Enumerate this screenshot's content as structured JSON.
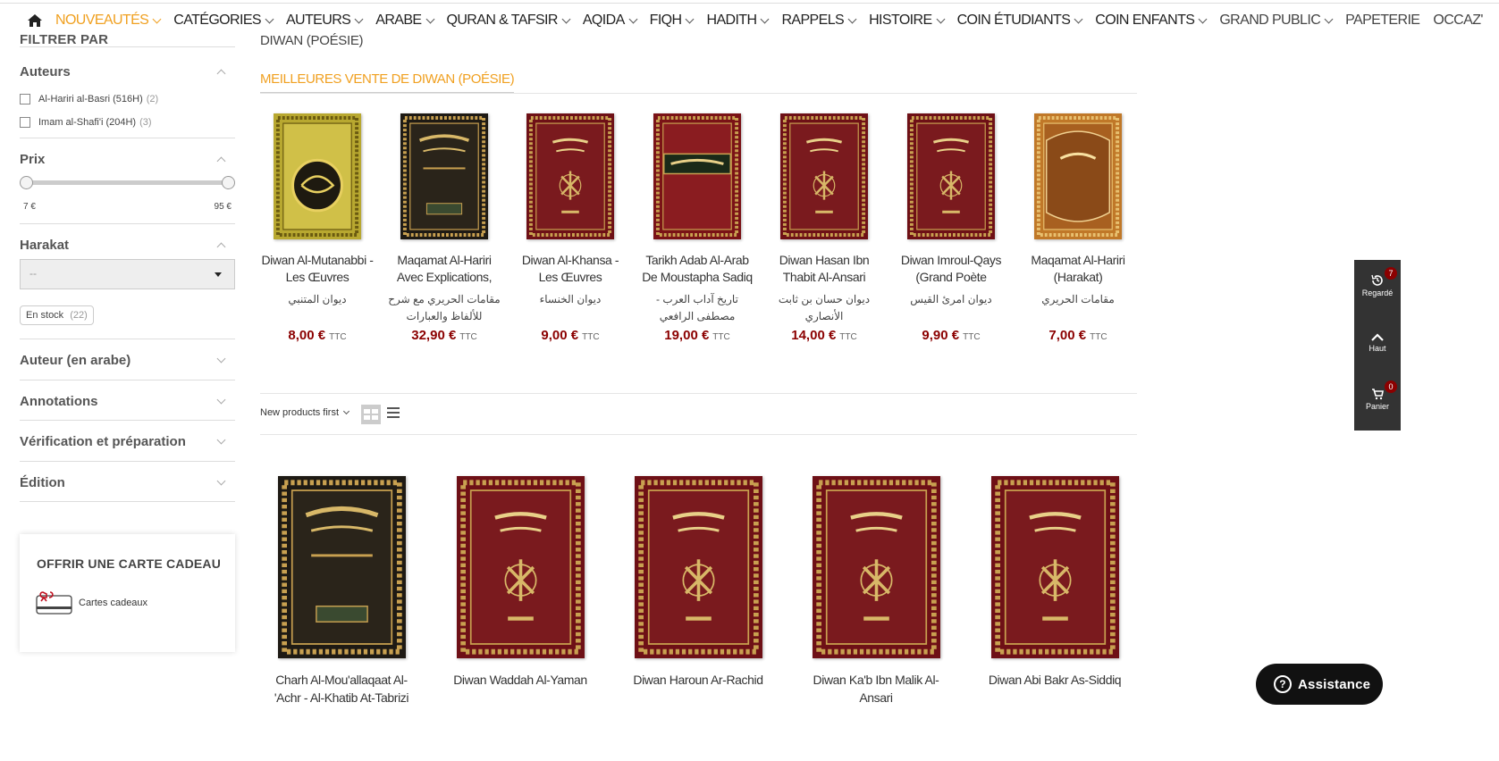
{
  "nav": {
    "items": [
      {
        "label": "NOUVEAUTÉS",
        "active": true,
        "chevron": true
      },
      {
        "label": "CATÉGORIES",
        "chevron": true
      },
      {
        "label": "AUTEURS",
        "chevron": true
      },
      {
        "label": "ARABE",
        "chevron": true
      },
      {
        "label": "QURAN & TAFSIR",
        "chevron": true
      },
      {
        "label": "AQIDA",
        "chevron": true
      },
      {
        "label": "FIQH",
        "chevron": true
      },
      {
        "label": "HADITH",
        "chevron": true
      },
      {
        "label": "RAPPELS",
        "chevron": true
      },
      {
        "label": "HISTOIRE",
        "chevron": true
      },
      {
        "label": "COIN ÉTUDIANTS",
        "chevron": true
      },
      {
        "label": "COIN ENFANTS",
        "chevron": true
      },
      {
        "label": "GRAND PUBLIC",
        "chevron": true
      },
      {
        "label": "PAPETERIE",
        "chevron": false
      },
      {
        "label": "OCCAZ'",
        "chevron": false
      }
    ],
    "accent": "#f0a020"
  },
  "sidebar": {
    "title": "FILTRER PAR",
    "authors": {
      "label": "Auteurs",
      "options": [
        {
          "name": "Al-Hariri al-Basri (516H)",
          "count": "(2)"
        },
        {
          "name": "Imam al-Shafi'i (204H)",
          "count": "(3)"
        }
      ]
    },
    "price": {
      "label": "Prix",
      "min": "7 €",
      "max": "95 €"
    },
    "harakat": {
      "label": "Harakat",
      "select_value": "--",
      "stock_badge": "En stock",
      "stock_count": "(22)"
    },
    "collapsed": [
      "Auteur (en arabe)",
      "Annotations",
      "Vérification et préparation",
      "Édition"
    ],
    "gift": {
      "title": "OFFRIR UNE CARTE CADEAU",
      "link": "Cartes cadeaux"
    }
  },
  "main": {
    "breadcrumb": "DIWAN (POÉSIE)",
    "best_title": "MEILLEURES VENTE DE DIWAN (POÉSIE)",
    "ttc": "TTC",
    "bestsellers": [
      {
        "name": "Diwan Al-Mutanabbi - Les Œuvres Complètes",
        "arabic": "ديوان المتنبي",
        "price": "8,00 €",
        "cover": "gold"
      },
      {
        "name": "Maqamat Al-Hariri Avec Explications,",
        "arabic": "مقامات الحريري مع شرح للألفاظ والعبارات",
        "price": "32,90 €",
        "cover": "black"
      },
      {
        "name": "Diwan Al-Khansa - Les Œuvres Complètes -",
        "arabic": "ديوان الخنساء",
        "price": "9,00 €",
        "cover": "red"
      },
      {
        "name": "Tarikh Adab Al-Arab De Moustapha Sadiq",
        "arabic": "تاريخ آداب العرب - مصطفى الرافعي",
        "price": "19,00 €",
        "cover": "redgreen"
      },
      {
        "name": "Diwan Hasan Ibn Thabit Al-Ansari",
        "arabic": "ديوان حسان بن ثابت الأنصاري",
        "price": "14,00 €",
        "cover": "red"
      },
      {
        "name": "Diwan Imroul-Qays (Grand Poète",
        "arabic": "ديوان امرئ القيس",
        "price": "9,90 €",
        "cover": "red"
      },
      {
        "name": "Maqamat Al-Hariri (Harakat)",
        "arabic": "مقامات الحريري",
        "price": "7,00 €",
        "cover": "orange"
      }
    ],
    "sort_label": "New products first",
    "products": [
      {
        "name": "Charh Al-Mou'allaqaat Al-'Achr - Al-Khatib At-Tabrizi",
        "cover": "black"
      },
      {
        "name": "Diwan Waddah Al-Yaman",
        "cover": "red"
      },
      {
        "name": "Diwan Haroun Ar-Rachid",
        "cover": "red"
      },
      {
        "name": "Diwan Ka'b Ibn Malik Al-Ansari",
        "cover": "red"
      },
      {
        "name": "Diwan Abi Bakr As-Siddiq",
        "cover": "red"
      }
    ],
    "price_color": "#8b0000"
  },
  "rightbar": {
    "viewed": {
      "label": "Regardé",
      "count": "7"
    },
    "top": {
      "label": "Haut"
    },
    "cart": {
      "label": "Panier",
      "count": "0"
    }
  },
  "assist": {
    "label": "Assistance"
  }
}
